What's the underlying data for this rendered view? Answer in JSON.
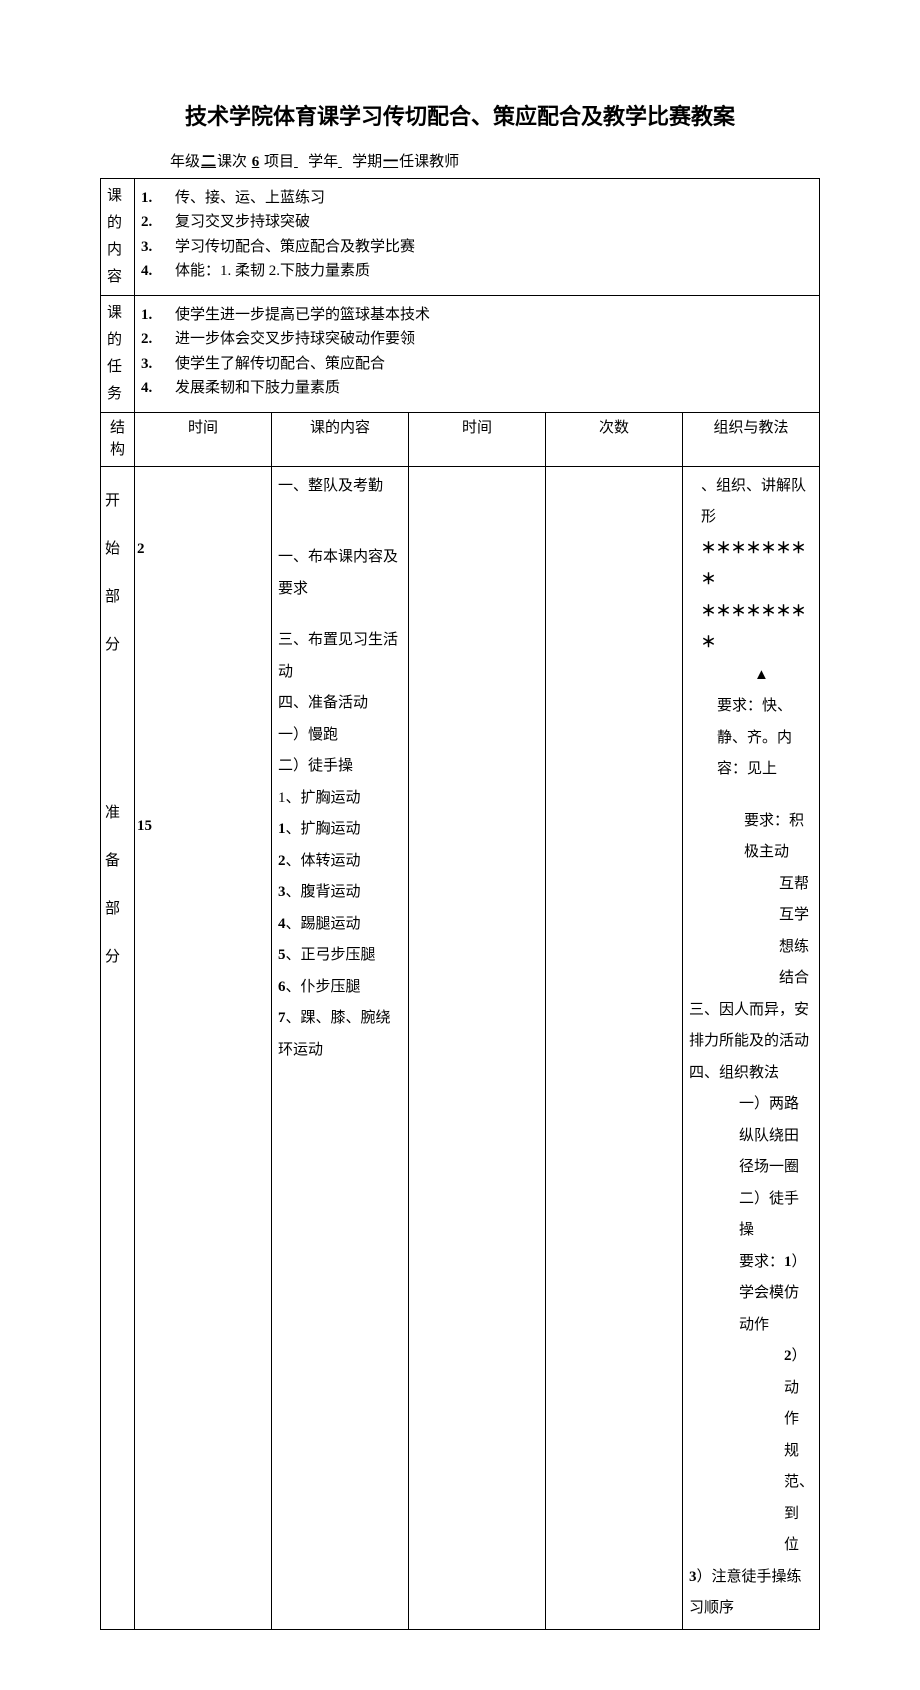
{
  "title": "技术学院体育课学习传切配合、策应配合及教学比赛教案",
  "meta": {
    "grade_label": "年级",
    "grade_value": "二",
    "session_label": "课次",
    "session_value": "6",
    "project_label": "项目",
    "year_label": "学年",
    "term_label": "学期",
    "term_value": "一",
    "teacher_label": "任课教师"
  },
  "kdnr": {
    "label": "课的内容",
    "items": [
      {
        "num": "1.",
        "text": "传、接、运、上蓝练习"
      },
      {
        "num": "2.",
        "text": "复习交叉步持球突破"
      },
      {
        "num": "3.",
        "text": "学习传切配合、策应配合及教学比赛"
      },
      {
        "num": "4.",
        "text": "体能：1. 柔韧 2.下肢力量素质"
      }
    ]
  },
  "kdrw": {
    "label": "课的任务",
    "items": [
      {
        "num": "1.",
        "text": "使学生进一步提高已学的篮球基本技术"
      },
      {
        "num": "2.",
        "text": "进一步体会交叉步持球突破动作要领"
      },
      {
        "num": "3.",
        "text": "使学生了解传切配合、策应配合"
      },
      {
        "num": "4.",
        "text": "发展柔韧和下肢力量素质"
      }
    ]
  },
  "headers": {
    "struct": "结构",
    "time": "时间",
    "content": "课的内容",
    "time2": "时间",
    "count": "次数",
    "method": "组织与教法"
  },
  "row1": {
    "struct": "开始部分",
    "time": "2",
    "content": {
      "l1": "一、整队及考勤",
      "l2": "一、布本课内容及要求"
    },
    "method": {
      "l1": "、组织、讲解队形",
      "l2": "＊＊＊＊＊＊＊＊",
      "l3": "＊＊＊＊＊＊＊＊",
      "l4": "▲",
      "l5": "要求：快、静、齐。内容：见上",
      "l6": "要求：积极主动"
    }
  },
  "row2": {
    "struct": "准备部分",
    "time": "15",
    "content": [
      "三、布置见习生活动",
      "四、准备活动",
      "一）慢跑",
      "二）徒手操",
      "1、扩胸运动",
      "2、体转运动",
      "3、腹背运动",
      "4、踢腿运动",
      "5、正弓步压腿",
      "6、仆步压腿",
      "7、踝、膝、腕绕环运动"
    ],
    "method": [
      "互帮互学",
      "想练结合",
      "三、因人而异，安排力所能及的活动",
      "四、组织教法",
      "一）两路纵队绕田径场一圈",
      "二）徒手操",
      "要求：1）学会模仿动作",
      "2）动作规范、到位",
      "3）注意徒手操练习顺序"
    ]
  }
}
